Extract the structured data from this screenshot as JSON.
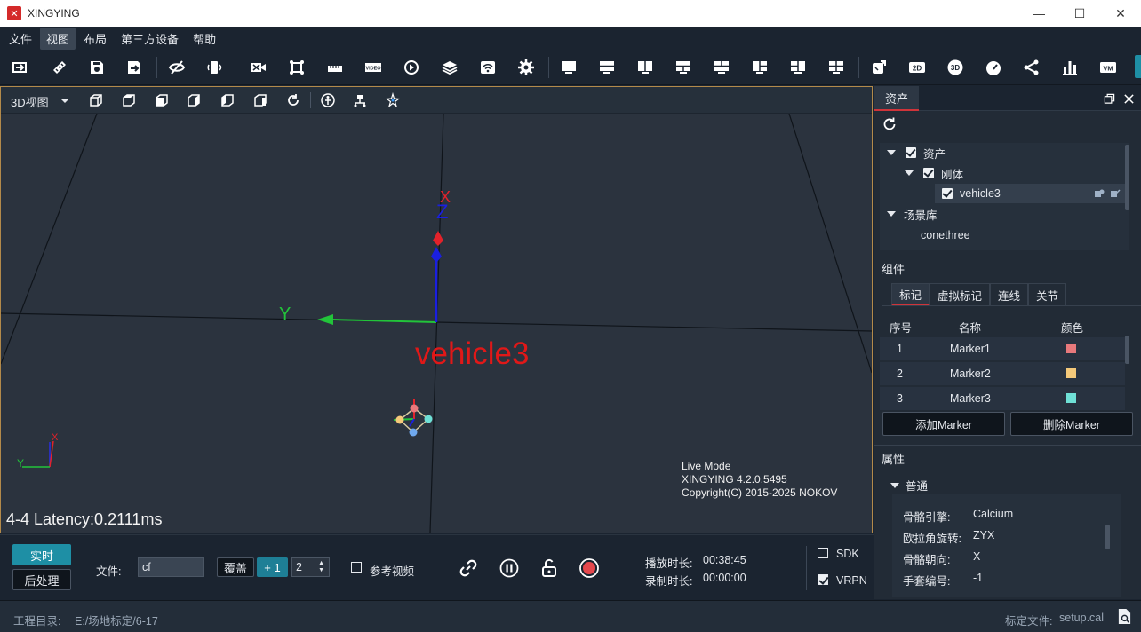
{
  "window": {
    "title": "XINGYING",
    "minimize": "—",
    "maximize": "☐",
    "close": "✕"
  },
  "menu": [
    "文件",
    "视图",
    "布局",
    "第三方设备",
    "帮助"
  ],
  "toolbar_icons": [
    "open-icon",
    "ruler-icon",
    "save-icon",
    "save-as-icon",
    "hide-icon",
    "device-icon",
    "camera-off-icon",
    "capture-frame-icon",
    "ruler-bar-icon",
    "video-icon",
    "playback-icon",
    "layers-icon",
    "wifi-icon",
    "settings-icon",
    "layout-1-icon",
    "layout-2-icon",
    "layout-3-icon",
    "layout-4-icon",
    "layout-5-icon",
    "layout-6-icon",
    "layout-7-icon",
    "layout-8-icon",
    "export-icon",
    "2d-icon",
    "3d-icon",
    "gauge-icon",
    "skeleton-icon",
    "bar-chart-icon",
    "vm-icon"
  ],
  "toolbar_text": {
    "video": "VIDEO",
    "two_d": "2D",
    "three_d": "3D",
    "vm": "VM"
  },
  "viewport": {
    "mode": "3D视图",
    "axis_z": "Z",
    "axis_y": "Y",
    "axis_x": "X",
    "rigid_body_label": "vehicle3",
    "mini_axis_x": "X",
    "mini_axis_y": "Y",
    "info_mode": "Live Mode",
    "info_version": "XINGYING 4.2.0.5495",
    "info_copyright": "Copyright(C) 2015-2025 NOKOV",
    "latency": "4-4 Latency:0.2111ms"
  },
  "panel": {
    "tab": "资产",
    "tree": {
      "root": "资产",
      "rigid": "刚体",
      "vehicle": "vehicle3",
      "scene": "场景库",
      "scene_item": "conethree"
    },
    "components_title": "组件",
    "component_tabs": [
      "标记",
      "虚拟标记",
      "连线",
      "关节"
    ],
    "marker_headers": {
      "index": "序号",
      "name": "名称",
      "color": "颜色"
    },
    "markers": [
      {
        "index": "1",
        "name": "Marker1",
        "color": "#e8797c"
      },
      {
        "index": "2",
        "name": "Marker2",
        "color": "#f4c97a"
      },
      {
        "index": "3",
        "name": "Marker3",
        "color": "#6fe0d6"
      }
    ],
    "add_marker": "添加Marker",
    "delete_marker": "删除Marker",
    "properties_title": "属性",
    "general": "普通",
    "props": [
      {
        "key": "骨骼引擎:",
        "value": "Calcium"
      },
      {
        "key": "欧拉角旋转:",
        "value": "ZYX"
      },
      {
        "key": "骨骼朝向:",
        "value": "X"
      },
      {
        "key": "手套编号:",
        "value": "-1"
      }
    ]
  },
  "bottom": {
    "realtime": "实时",
    "postprocess": "后处理",
    "file_label": "文件:",
    "file_value": "cf",
    "overwrite": "覆盖",
    "plus_one": "+ 1",
    "counter": "2",
    "ref_video": "参考视频",
    "play_label": "播放时长:",
    "play_value": "00:38:45",
    "record_label": "录制时长:",
    "record_value": "00:00:00",
    "sdk": "SDK",
    "vrpn": "VRPN"
  },
  "status": {
    "project_label": "工程目录:",
    "project_path": "E:/场地标定/6-17",
    "calib_label": "标定文件:",
    "calib_file": "setup.cal"
  }
}
